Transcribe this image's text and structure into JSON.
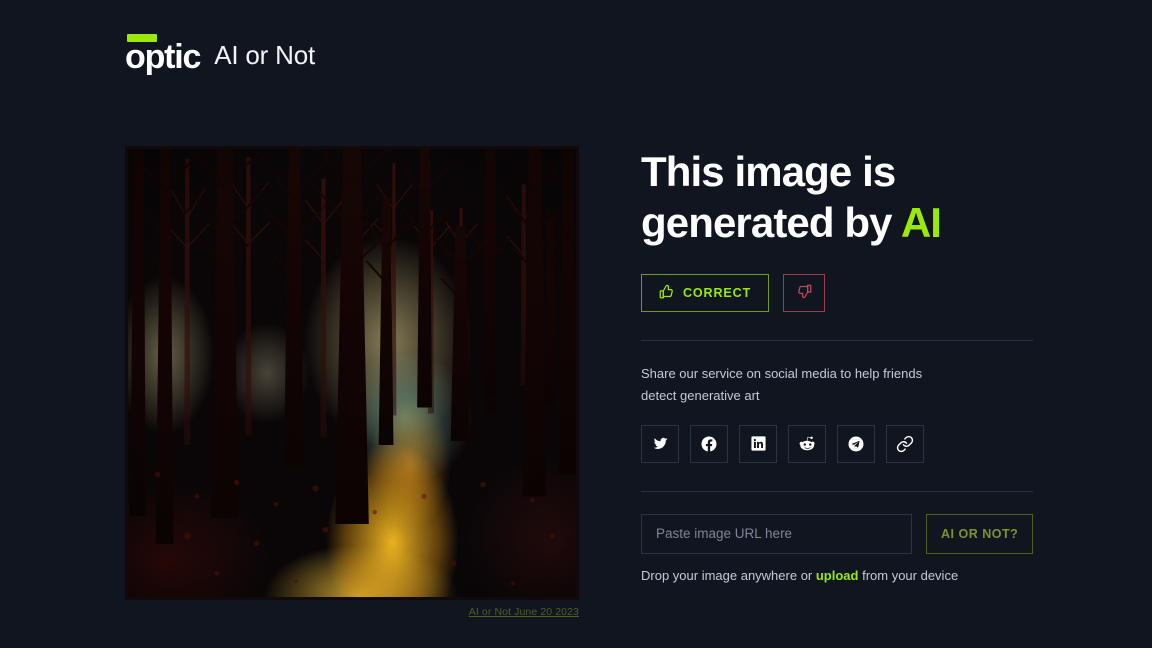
{
  "brand": {
    "logo_word": "optic",
    "logo_bar_color": "#9BE80B",
    "product_name": "AI or Not"
  },
  "artwork": {
    "caption": "AI or Not June 20 2023",
    "alt": "painting of a misty forest with bare dark trees, red sky and glowing orange path"
  },
  "result": {
    "headline_line1": "This image is",
    "headline_line2_prefix": "generated by",
    "headline_verdict": "AI",
    "verdict_color": "#9BE80B",
    "correct_label": "CORRECT",
    "correct_icon": "thumbs-up-icon",
    "correct_color": "#9BE80B",
    "incorrect_icon": "thumbs-down-icon",
    "incorrect_color": "#a23a4e"
  },
  "share": {
    "text_line1": "Share our service on social media to help friends",
    "text_line2": "detect generative art",
    "buttons": [
      {
        "name": "twitter",
        "icon": "twitter-icon"
      },
      {
        "name": "facebook",
        "icon": "facebook-icon"
      },
      {
        "name": "linkedin",
        "icon": "linkedin-icon"
      },
      {
        "name": "reddit",
        "icon": "reddit-icon"
      },
      {
        "name": "telegram",
        "icon": "telegram-icon"
      },
      {
        "name": "copylink",
        "icon": "link-icon"
      }
    ]
  },
  "upload": {
    "url_placeholder": "Paste image URL here",
    "url_value": "",
    "submit_label": "AI OR NOT?",
    "drop_prefix": "Drop your image anywhere or ",
    "drop_link": "upload",
    "drop_suffix": " from your device"
  },
  "theme": {
    "background": "#101520",
    "accent_green": "#9BE80B",
    "border_dim": "#2b3242",
    "text_muted": "#c5cbd6"
  }
}
